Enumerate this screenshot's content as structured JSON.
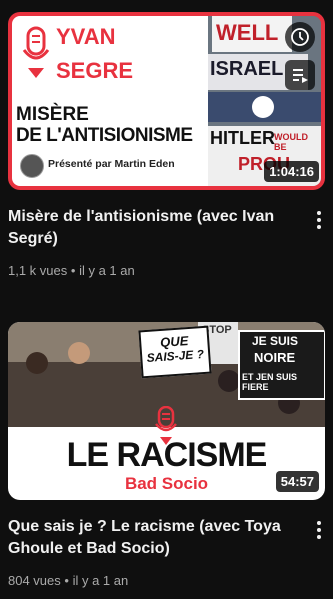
{
  "videos": [
    {
      "title": "Misère de l'antisionisme (avec Ivan Segré)",
      "views": "1,1 k vues",
      "age": "il y a 1 an",
      "duration": "1:04:16",
      "thumb": {
        "brand_line1": "YVAN",
        "brand_line2": "SEGRE",
        "headline_line1": "MISÈRE",
        "headline_line2": "DE L'ANTISIONISME",
        "presenter": "Présenté par Martin Eden",
        "sign_well": "WELL",
        "sign_isr": "ISRAEL",
        "sign_hitler": "HITLER",
        "sign_would": "WOULD BE",
        "sign_prou": "PROU"
      }
    },
    {
      "title": "Que sais je ? Le racisme (avec Toya Ghoule et Bad Socio)",
      "views": "804 vues",
      "age": "il y a 1 an",
      "duration": "54:57",
      "thumb": {
        "que": "QUE",
        "saisje": "SAIS-JE ?",
        "stop": "STOP",
        "sign1_l1": "JE SUIS",
        "sign1_l2": "NOIRE",
        "sign1_l3": "ET JEN SUIS FIERE",
        "headline": "LE RACISME",
        "subtitle": "Bad Socio"
      }
    }
  ],
  "colors": {
    "accent_red": "#d92b3a",
    "bg": "#0f0f0f",
    "meta": "#aaaaaa"
  }
}
